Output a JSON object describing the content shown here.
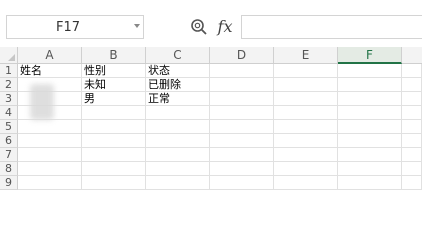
{
  "toolbar": {
    "name_box_value": "F17",
    "formula_label": "fx",
    "formula_value": ""
  },
  "sheet": {
    "columns": [
      "A",
      "B",
      "C",
      "D",
      "E",
      "F"
    ],
    "selected_column": "F",
    "rows": [
      "1",
      "2",
      "3",
      "4",
      "5",
      "6",
      "7",
      "8",
      "9"
    ],
    "cells": [
      [
        "姓名",
        "性别",
        "状态"
      ],
      [
        "",
        "未知",
        "已删除"
      ],
      [
        "",
        "男",
        "正常"
      ]
    ]
  },
  "colors": {
    "accent": "#217346",
    "header_bg": "#f3f3f3",
    "gridline": "#e1e1e1"
  }
}
